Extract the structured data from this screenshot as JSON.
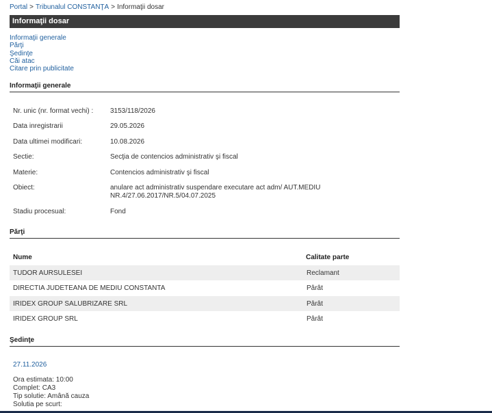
{
  "breadcrumb": {
    "items": [
      "Portal",
      "Tribunalul CONSTANŢA",
      "Informaţii dosar"
    ],
    "separator": ">"
  },
  "title": "Informaţii dosar",
  "nav": {
    "links": [
      "Informaţii generale",
      "Părţi",
      "Şedinţe",
      "Căi atac",
      "Citare prin publicitate"
    ]
  },
  "general": {
    "heading": "Informaţii generale",
    "rows": [
      {
        "label": "Nr. unic (nr. format vechi) :",
        "value": "3153/118/2026"
      },
      {
        "label": "Data inregistrarii",
        "value": "29.05.2026"
      },
      {
        "label": "Data ultimei modificari:",
        "value": "10.08.2026"
      },
      {
        "label": "Sectie:",
        "value": "Secţia de contencios administrativ şi fiscal"
      },
      {
        "label": "Materie:",
        "value": "Contencios administrativ şi fiscal"
      },
      {
        "label": "Obiect:",
        "value_line1": "anulare act administrativ suspendare executare act adm/ AUT.MEDIU",
        "value_line2": "NR.4/27.06.2017/NR.5/04.07.2025"
      },
      {
        "label": "Stadiu procesual:",
        "value": "Fond"
      }
    ]
  },
  "parti": {
    "heading": "Părţi",
    "columns": [
      "Nume",
      "Calitate parte"
    ],
    "rows": [
      {
        "name": "TUDOR AURSULESEI",
        "role": "Reclamant"
      },
      {
        "name": "DIRECTIA JUDETEANA DE MEDIU CONSTANTA",
        "role": "Pârât"
      },
      {
        "name": "IRIDEX GROUP SALUBRIZARE SRL",
        "role": "Pârât"
      },
      {
        "name": "IRIDEX GROUP SRL",
        "role": "Pârât"
      }
    ]
  },
  "sedinte": {
    "heading": "Şedinţe",
    "date": "27.11.2026",
    "lines": [
      "Ora estimata: 10:00",
      "Complet: CA3",
      "Tip solutie: Amână cauza",
      "Solutia pe scurt:"
    ]
  },
  "colors": {
    "link": "#1f5f9e",
    "title_bar": "#3b3b3b",
    "row_alt": "#eeeeee"
  }
}
